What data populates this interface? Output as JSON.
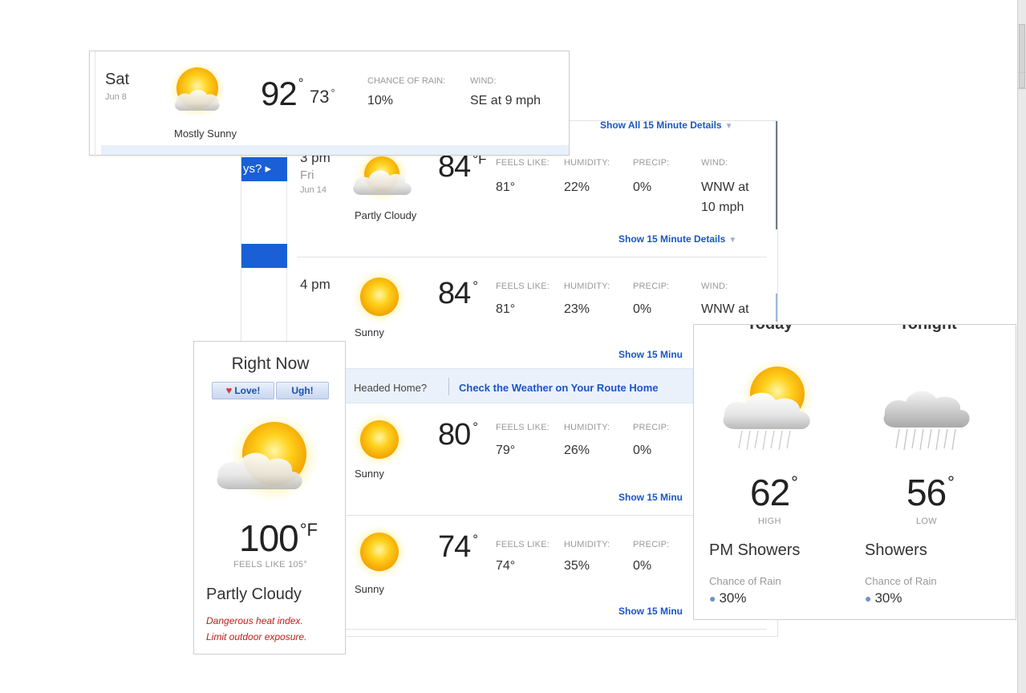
{
  "sat_card": {
    "day": "Sat",
    "date": "Jun 8",
    "condition": "Mostly Sunny",
    "high": "92",
    "low": "73",
    "deg": "°",
    "rain_label": "CHANCE OF RAIN:",
    "rain_value": "10%",
    "wind_label": "WIND:",
    "wind_value": "SE at 9 mph",
    "icon": "mostly-sunny-icon"
  },
  "hourly": {
    "ask_tab": "ys? ▸",
    "show_all": "Show All 15 Minute Details",
    "show_details": "Show 15 Minute Details",
    "show_details_cut": "Show 15 Minu",
    "labels": {
      "feels": "FEELS LIKE:",
      "humidity": "HUMIDITY:",
      "precip": "PRECIP:",
      "wind": "WIND:"
    },
    "rows": [
      {
        "time": "3 pm",
        "day": "Fri",
        "date": "Jun 14",
        "condition": "Partly Cloudy",
        "temp": "84",
        "unit": "°F",
        "feels": "81°",
        "humidity": "22%",
        "precip": "0%",
        "wind_line1": "WNW at",
        "wind_line2": "10 mph",
        "icon": "partly-cloudy-icon"
      },
      {
        "time": "4 pm",
        "condition": "Sunny",
        "temp": "84",
        "unit": "°",
        "feels": "81°",
        "humidity": "23%",
        "precip": "0%",
        "wind_line1": "WNW at",
        "icon": "sunny-icon"
      },
      {
        "condition": "Sunny",
        "temp": "80",
        "unit": "°",
        "feels": "79°",
        "humidity": "26%",
        "precip": "0%",
        "icon": "sunny-icon"
      },
      {
        "condition": "Sunny",
        "temp": "74",
        "unit": "°",
        "feels": "74°",
        "humidity": "35%",
        "precip": "0%",
        "icon": "sunny-icon"
      }
    ],
    "headed_home": "Headed Home?",
    "route_link": "Check the Weather on Your Route Home"
  },
  "right_now": {
    "title": "Right Now",
    "love": "Love!",
    "ugh": "Ugh!",
    "temp": "100",
    "unit": "°F",
    "feels": "FEELS LIKE 105°",
    "condition": "Partly Cloudy",
    "warning_line1": "Dangerous heat index.",
    "warning_line2": "Limit outdoor exposure.",
    "icon": "partly-cloudy-icon"
  },
  "today_tonight": {
    "today_head": "Today",
    "tonight_head": "Tonight",
    "today": {
      "temp": "62",
      "deg": "°",
      "label": "HIGH",
      "condition": "PM Showers",
      "rain_label": "Chance of Rain",
      "rain_value": "30%",
      "icon": "pm-showers-icon"
    },
    "tonight": {
      "temp": "56",
      "deg": "°",
      "label": "LOW",
      "condition": "Showers",
      "rain_label": "Chance of Rain",
      "rain_value": "30%",
      "icon": "showers-icon"
    }
  },
  "colors": {
    "accent": "#1a56c4",
    "tab_blue": "#1a5fd6",
    "warning": "#c41a1a"
  }
}
